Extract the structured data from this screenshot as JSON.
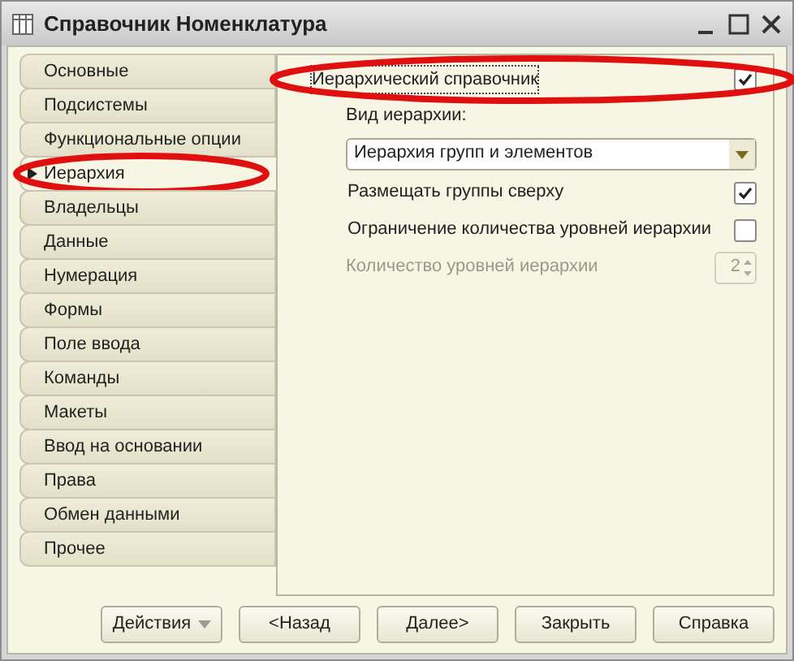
{
  "window": {
    "title": "Справочник Номенклатура"
  },
  "tabs": [
    {
      "label": "Основные",
      "selected": false,
      "highlighted": false
    },
    {
      "label": "Подсистемы",
      "selected": false,
      "highlighted": false
    },
    {
      "label": "Функциональные опции",
      "selected": false,
      "highlighted": false
    },
    {
      "label": "Иерархия",
      "selected": true,
      "highlighted": true
    },
    {
      "label": "Владельцы",
      "selected": false,
      "highlighted": false
    },
    {
      "label": "Данные",
      "selected": false,
      "highlighted": false
    },
    {
      "label": "Нумерация",
      "selected": false,
      "highlighted": false
    },
    {
      "label": "Формы",
      "selected": false,
      "highlighted": false
    },
    {
      "label": "Поле ввода",
      "selected": false,
      "highlighted": false
    },
    {
      "label": "Команды",
      "selected": false,
      "highlighted": false
    },
    {
      "label": "Макеты",
      "selected": false,
      "highlighted": false
    },
    {
      "label": "Ввод на основании",
      "selected": false,
      "highlighted": false
    },
    {
      "label": "Права",
      "selected": false,
      "highlighted": false
    },
    {
      "label": "Обмен данными",
      "selected": false,
      "highlighted": false
    },
    {
      "label": "Прочее",
      "selected": false,
      "highlighted": false
    }
  ],
  "panel": [
    {
      "kind": "checkbox",
      "label": "Иерархический справочник",
      "checked": true,
      "indented": false,
      "highlighted": true,
      "disabled": false
    },
    {
      "kind": "label",
      "label": "Вид иерархии:",
      "indented": true
    },
    {
      "kind": "dropdown",
      "value": "Иерархия групп и элементов",
      "indented": false
    },
    {
      "kind": "checkbox",
      "label": "Размещать группы сверху",
      "checked": true,
      "indented": true,
      "highlighted": false,
      "disabled": false
    },
    {
      "kind": "checkbox",
      "label": "Ограничение количества уровней иерархии",
      "checked": false,
      "indented": true,
      "highlighted": false,
      "disabled": false
    },
    {
      "kind": "spinner",
      "label": "Количество уровней иерархии",
      "value": "2",
      "indented": true,
      "disabled": true
    }
  ],
  "buttons": [
    {
      "label": "Действия",
      "kind": "menu"
    },
    {
      "label": "<Назад",
      "kind": "plain"
    },
    {
      "label": "Далее>",
      "kind": "plain"
    },
    {
      "label": "Закрыть",
      "kind": "plain"
    },
    {
      "label": "Справка",
      "kind": "plain"
    }
  ]
}
